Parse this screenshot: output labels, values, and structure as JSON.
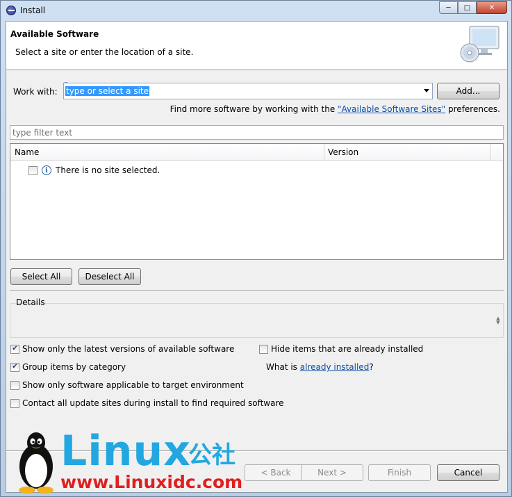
{
  "window": {
    "title": "Install",
    "controls": [
      "minimize",
      "maximize",
      "close"
    ]
  },
  "banner": {
    "title": "Available Software",
    "description": "Select a site or enter the location of a site."
  },
  "work_with": {
    "label": "Work with:",
    "combo_value": "type or select a site",
    "add_label": "Add..."
  },
  "find_more": {
    "prefix": "Find more software by working with the ",
    "link": "\"Available Software Sites\"",
    "suffix": " preferences."
  },
  "filter": {
    "placeholder": "type filter text"
  },
  "table": {
    "columns": [
      "Name",
      "Version"
    ],
    "rows": [
      {
        "checked": false,
        "text": "There is no site selected."
      }
    ]
  },
  "buttons": {
    "select_all": "Select All",
    "deselect_all": "Deselect All",
    "back": "< Back",
    "next": "Next >",
    "finish": "Finish",
    "cancel": "Cancel"
  },
  "details": {
    "label": "Details"
  },
  "options": {
    "latest_versions": {
      "label": "Show only the latest versions of available software",
      "checked": true
    },
    "hide_installed": {
      "label": "Hide items that are already installed",
      "checked": false
    },
    "group_by_category": {
      "label": "Group items by category",
      "checked": true
    },
    "what_is_prefix": "What is ",
    "what_is_link": "already installed",
    "what_is_suffix": "?",
    "target_env": {
      "label": "Show only software applicable to target environment",
      "checked": false
    },
    "contact_sites": {
      "label": "Contact all update sites during install to find required software",
      "checked": false
    }
  },
  "watermark": {
    "brand": "Linux",
    "brand_cn": "公社",
    "url": "www.Linuxidc.com"
  }
}
